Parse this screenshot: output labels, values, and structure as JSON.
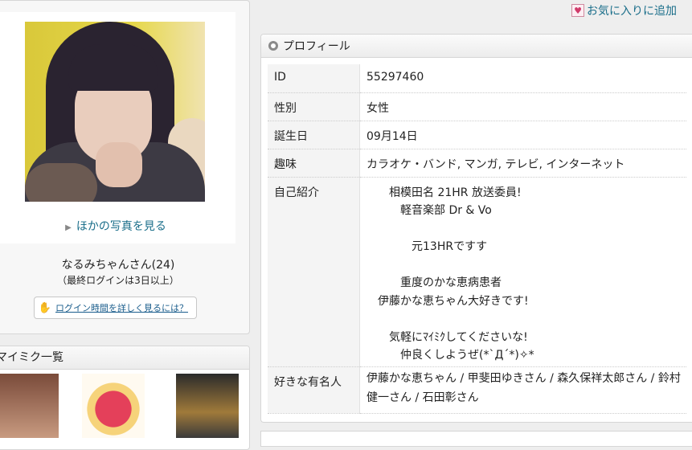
{
  "favorite": {
    "label": "お気に入りに追加",
    "icon": "heart-icon"
  },
  "left": {
    "more_photos": "ほかの写真を見る",
    "username": "なるみちゃんさん(24)",
    "last_login": "（最終ログインは3日以上）",
    "login_help": "ログイン時間を詳しく見るには？"
  },
  "mymixi": {
    "title": "マイミク一覧"
  },
  "profile": {
    "title": "プロフィール",
    "rows": [
      {
        "key": "ID",
        "value": "55297460"
      },
      {
        "key": "性別",
        "value": "女性"
      },
      {
        "key": "誕生日",
        "value": "09月14日"
      },
      {
        "key": "趣味",
        "value": "カラオケ・バンド, マンガ, テレビ, インターネット"
      },
      {
        "key": "自己紹介",
        "lines": [
          "　　相模田名 21HR 放送委員!",
          "　　　軽音楽部 Dr & Vo",
          "",
          "　　　　元13HRですす",
          "",
          "　　　重度のかな恵病患者",
          "　伊藤かな恵ちゃん大好きです!",
          "",
          "　　気軽にﾏｲﾐｸしてくださいな!",
          "　　　仲良くしようぜ(*`Д´*)✧*"
        ]
      },
      {
        "key": "好きな有名人",
        "value": "伊藤かな恵ちゃん / 甲斐田ゆきさん / 森久保祥太郎さん / 鈴村健一さん / 石田彰さん"
      }
    ]
  }
}
